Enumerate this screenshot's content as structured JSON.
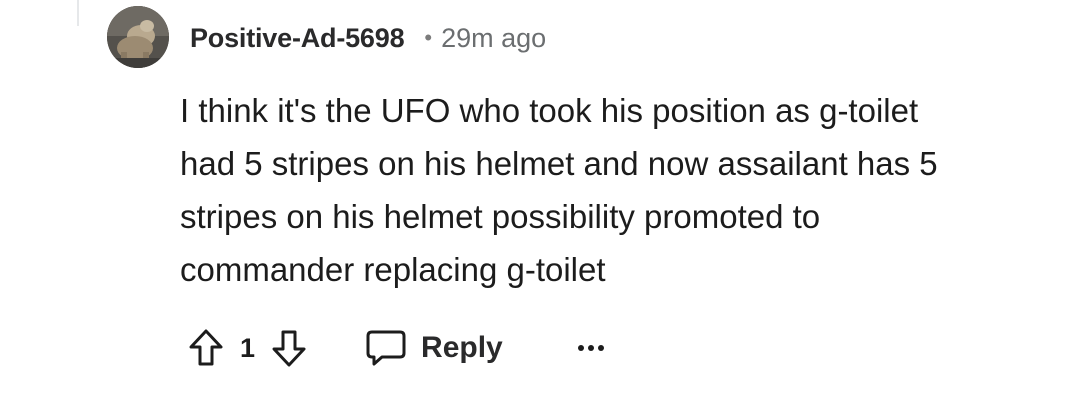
{
  "comment": {
    "username": "Positive-Ad-5698",
    "separator": "•",
    "time": "29m ago",
    "lines": [
      "I think it's the UFO who took his position as g-toilet",
      "had 5 stripes on his helmet and now assailant has 5",
      "stripes on his helmet possibility promoted to",
      "commander replacing g-toilet"
    ],
    "score": "1",
    "reply_label": "Reply",
    "icons": {
      "avatar": "avatar",
      "upvote": "arrow-up-outline-icon",
      "downvote": "arrow-down-outline-icon",
      "reply": "speech-bubble-icon",
      "more": "ellipsis-icon"
    },
    "colors": {
      "text": "#1c1c1c",
      "meta": "#6b6e70",
      "icon": "#1c1c1c"
    }
  }
}
